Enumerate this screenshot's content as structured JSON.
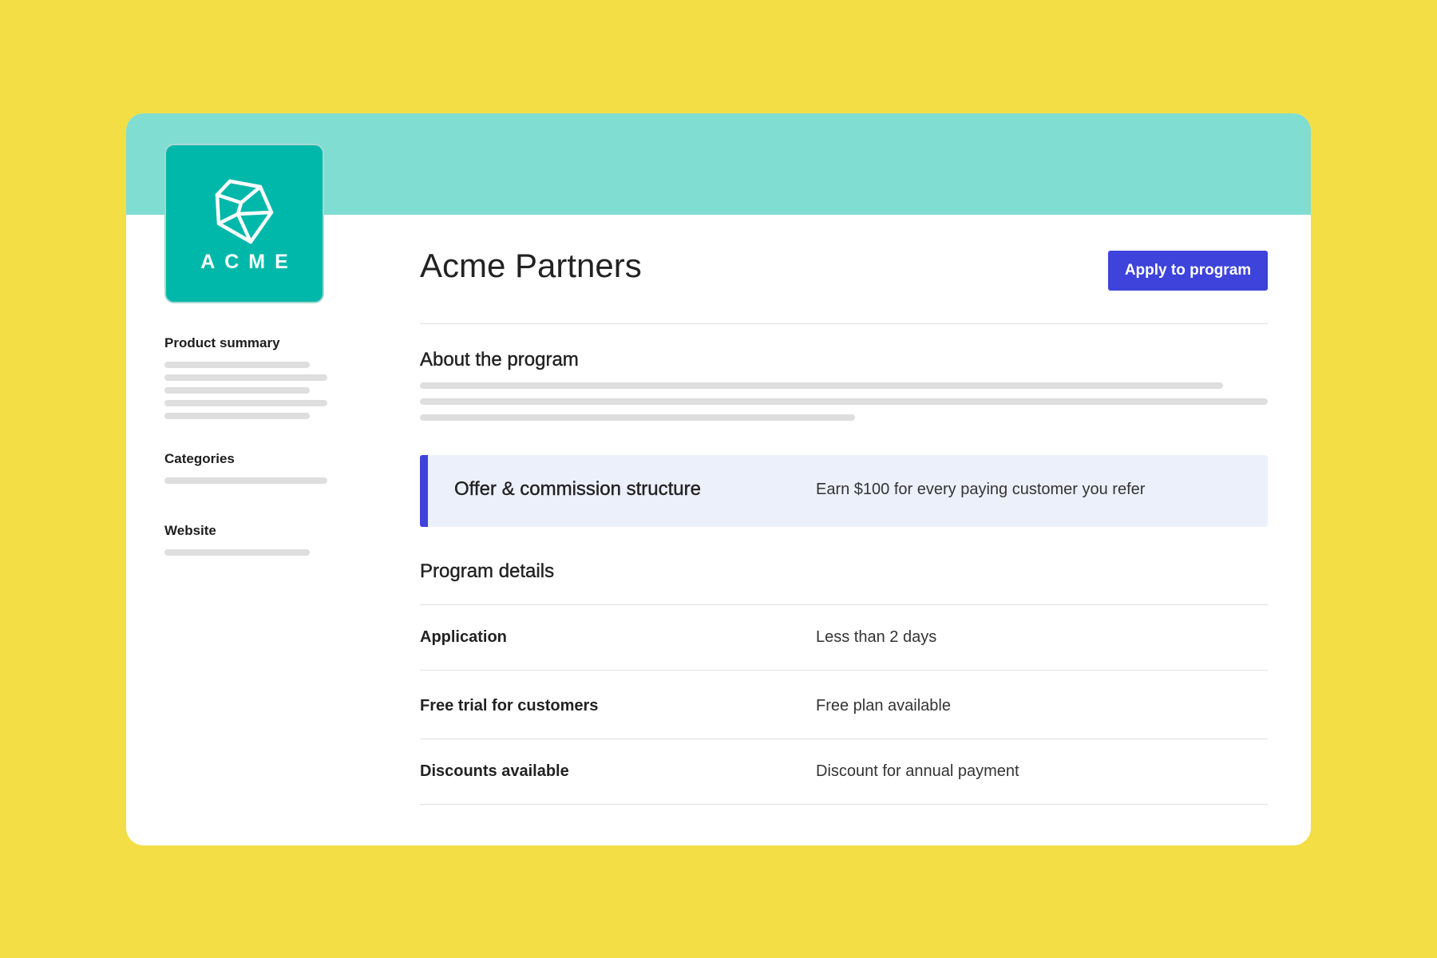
{
  "brand": {
    "logo_text": "ACME"
  },
  "sidebar": {
    "product_summary_heading": "Product summary",
    "categories_heading": "Categories",
    "website_heading": "Website"
  },
  "header": {
    "title": "Acme Partners",
    "apply_button_label": "Apply to program"
  },
  "about": {
    "heading": "About the program"
  },
  "offer": {
    "title": "Offer & commission structure",
    "description": "Earn $100 for every paying customer you refer"
  },
  "program_details": {
    "heading": "Program details",
    "rows": [
      {
        "label": "Application",
        "value": "Less than 2 days"
      },
      {
        "label": "Free trial for customers",
        "value": "Free plan available"
      },
      {
        "label": "Discounts available",
        "value": "Discount for annual payment"
      }
    ]
  },
  "colors": {
    "background": "#F3DF45",
    "banner": "#80DDD2",
    "logo": "#00B8AA",
    "accent": "#3D43DB",
    "offer_background": "#ECF0FB"
  },
  "icons": {
    "logo_mark": "wireframe-cube-icon"
  }
}
